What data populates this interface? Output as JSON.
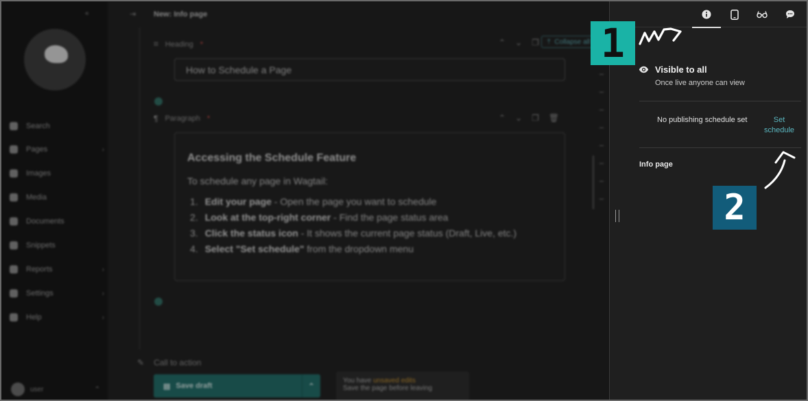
{
  "sidebar": {
    "collapse_label": "«",
    "items": [
      {
        "label": "Search",
        "icon": "search-icon",
        "chevron": ""
      },
      {
        "label": "Pages",
        "icon": "folder-icon",
        "chevron": "›"
      },
      {
        "label": "Images",
        "icon": "image-icon",
        "chevron": ""
      },
      {
        "label": "Media",
        "icon": "media-icon",
        "chevron": ""
      },
      {
        "label": "Documents",
        "icon": "document-icon",
        "chevron": ""
      },
      {
        "label": "Snippets",
        "icon": "snippet-icon",
        "chevron": ""
      },
      {
        "label": "Reports",
        "icon": "reports-icon",
        "chevron": "›"
      },
      {
        "label": "Settings",
        "icon": "settings-icon",
        "chevron": "›"
      },
      {
        "label": "Help",
        "icon": "help-icon",
        "chevron": "›"
      }
    ],
    "user": {
      "name": "user",
      "chevron": "⌃"
    }
  },
  "editor": {
    "toggle": "⇥",
    "title": "New: Info page",
    "heading_block": {
      "label": "Heading",
      "required": "*",
      "value": "How to Schedule a Page"
    },
    "collapse_all": "Collapse all",
    "paragraph_block": {
      "label": "Paragraph",
      "required": "*",
      "heading": "Accessing the Schedule Feature",
      "intro": "To schedule any page in Wagtail:",
      "steps": [
        {
          "num": "1.",
          "bold": "Edit your page",
          "rest": " - Open the page you want to schedule"
        },
        {
          "num": "2.",
          "bold": "Look at the top-right corner",
          "rest": " - Find the page status area"
        },
        {
          "num": "3.",
          "bold": "Click the status icon",
          "rest": " - It shows the current page status (Draft, Live, etc.)"
        },
        {
          "num": "4.",
          "bold": "Select \"Set schedule\"",
          "rest": " from the dropdown menu"
        }
      ]
    },
    "cta_label": "Call to action",
    "save": {
      "label": "Save draft",
      "chevron": "⌃"
    },
    "unsaved": {
      "prefix": "You have ",
      "highlight": "unsaved edits",
      "sub": "Save the page before leaving"
    }
  },
  "panel": {
    "tabs": [
      {
        "name": "info-icon",
        "active": true
      },
      {
        "name": "mobile-preview-icon",
        "active": false
      },
      {
        "name": "glasses-icon",
        "active": false
      },
      {
        "name": "comment-icon",
        "active": false
      }
    ],
    "visibility": {
      "title": "Visible to all",
      "subtitle": "Once live anyone can view"
    },
    "schedule": {
      "status": "No publishing schedule set",
      "link": "Set schedule"
    },
    "page_type": "Info page"
  },
  "annotations": {
    "marker_1": "1",
    "marker_2": "2",
    "colors": {
      "marker_1": "#1ab3a6",
      "marker_2": "#125c7a"
    }
  }
}
